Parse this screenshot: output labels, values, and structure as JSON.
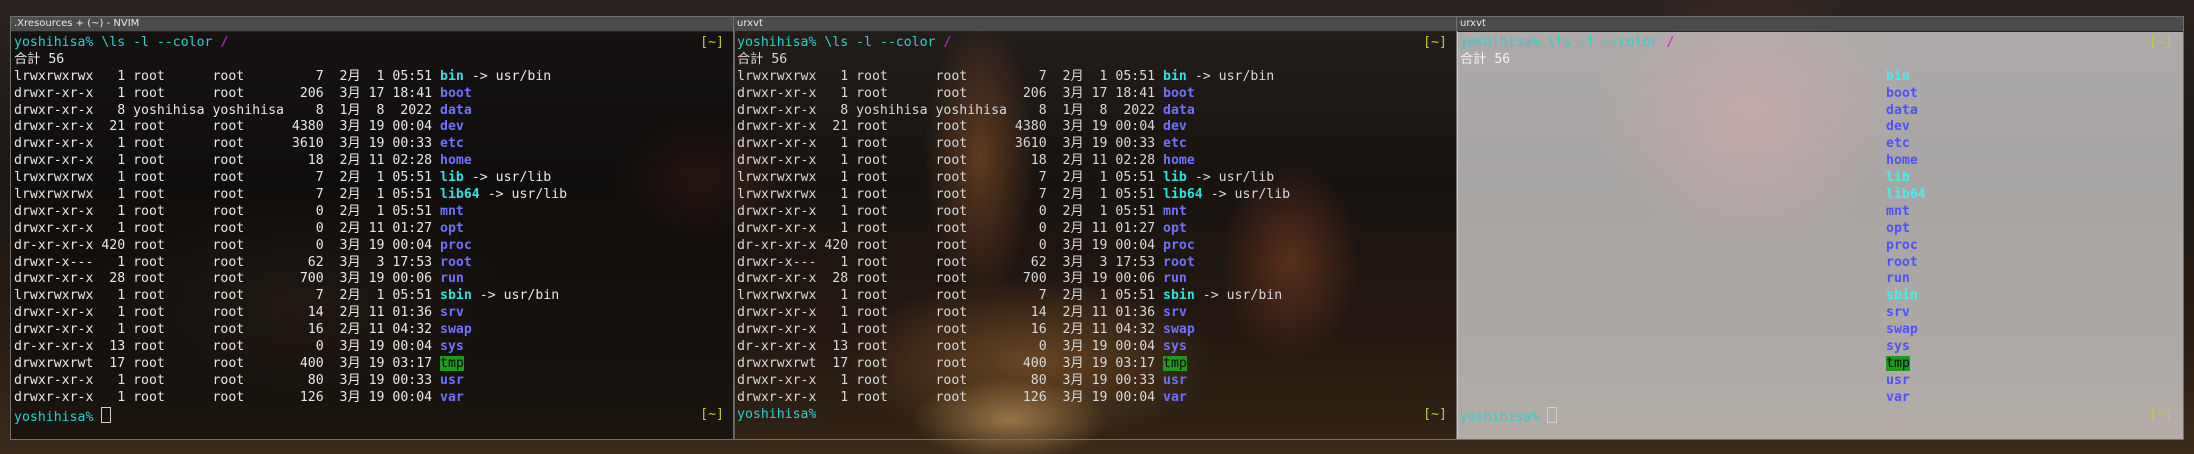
{
  "windows": [
    {
      "title": ".Xresources + (~) - NVIM"
    },
    {
      "title": "urxvt"
    },
    {
      "title": "urxvt"
    }
  ],
  "terminal": {
    "prompt": "yoshihisa%",
    "command": "\\ls -l --color",
    "slash": "/",
    "cwd_indicator": "[~]",
    "total_line": "合計 56",
    "rows": [
      {
        "meta": "lrwxrwxrwx   1 root      root         7  2月  1 05:51 ",
        "name": "bin",
        "target": " -> usr/bin",
        "kind": "link"
      },
      {
        "meta": "drwxr-xr-x   1 root      root       206  3月 17 18:41 ",
        "name": "boot",
        "target": "",
        "kind": "dir"
      },
      {
        "meta": "drwxr-xr-x   8 yoshihisa yoshihisa    8  1月  8  2022 ",
        "name": "data",
        "target": "",
        "kind": "dir"
      },
      {
        "meta": "drwxr-xr-x  21 root      root      4380  3月 19 00:04 ",
        "name": "dev",
        "target": "",
        "kind": "dir"
      },
      {
        "meta": "drwxr-xr-x   1 root      root      3610  3月 19 00:33 ",
        "name": "etc",
        "target": "",
        "kind": "dir"
      },
      {
        "meta": "drwxr-xr-x   1 root      root        18  2月 11 02:28 ",
        "name": "home",
        "target": "",
        "kind": "dir"
      },
      {
        "meta": "lrwxrwxrwx   1 root      root         7  2月  1 05:51 ",
        "name": "lib",
        "target": " -> usr/lib",
        "kind": "link"
      },
      {
        "meta": "lrwxrwxrwx   1 root      root         7  2月  1 05:51 ",
        "name": "lib64",
        "target": " -> usr/lib",
        "kind": "link"
      },
      {
        "meta": "drwxr-xr-x   1 root      root         0  2月  1 05:51 ",
        "name": "mnt",
        "target": "",
        "kind": "dir"
      },
      {
        "meta": "drwxr-xr-x   1 root      root         0  2月 11 01:27 ",
        "name": "opt",
        "target": "",
        "kind": "dir"
      },
      {
        "meta": "dr-xr-xr-x 420 root      root         0  3月 19 00:04 ",
        "name": "proc",
        "target": "",
        "kind": "dir"
      },
      {
        "meta": "drwxr-x---   1 root      root        62  3月  3 17:53 ",
        "name": "root",
        "target": "",
        "kind": "dir"
      },
      {
        "meta": "drwxr-xr-x  28 root      root       700  3月 19 00:06 ",
        "name": "run",
        "target": "",
        "kind": "dir"
      },
      {
        "meta": "lrwxrwxrwx   1 root      root         7  2月  1 05:51 ",
        "name": "sbin",
        "target": " -> usr/bin",
        "kind": "link"
      },
      {
        "meta": "drwxr-xr-x   1 root      root        14  2月 11 01:36 ",
        "name": "srv",
        "target": "",
        "kind": "dir"
      },
      {
        "meta": "drwxr-xr-x   1 root      root        16  2月 11 04:32 ",
        "name": "swap",
        "target": "",
        "kind": "dir"
      },
      {
        "meta": "dr-xr-xr-x  13 root      root         0  3月 19 00:04 ",
        "name": "sys",
        "target": "",
        "kind": "dir"
      },
      {
        "meta": "drwxrwxrwt  17 root      root       400  3月 19 03:17 ",
        "name": "tmp",
        "target": "",
        "kind": "tmp"
      },
      {
        "meta": "drwxr-xr-x   1 root      root        80  3月 19 00:33 ",
        "name": "usr",
        "target": "",
        "kind": "dir"
      },
      {
        "meta": "drwxr-xr-x   1 root      root       126  3月 19 00:04 ",
        "name": "var",
        "target": "",
        "kind": "dir"
      }
    ]
  },
  "colors": {
    "prompt": "#2ccfcf",
    "directory": "#7070ff",
    "symlink": "#30e0e0",
    "tmp_bg": "#1f9a1f",
    "cwd_indicator": "#c8c83a",
    "slash": "#cc22cc"
  }
}
